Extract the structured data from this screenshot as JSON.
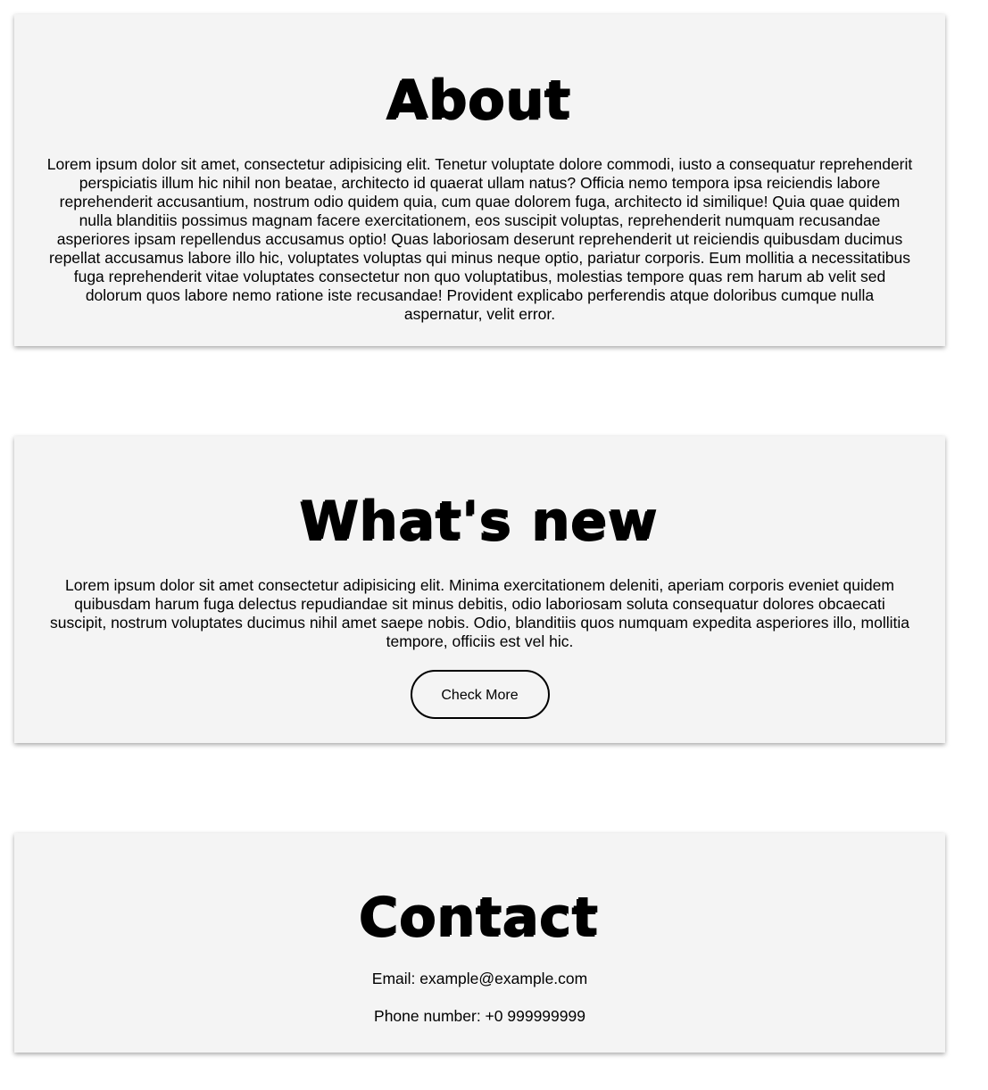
{
  "about": {
    "title": "About",
    "text": "Lorem ipsum dolor sit amet, consectetur adipisicing elit. Tenetur voluptate dolore commodi, iusto a consequatur reprehenderit perspiciatis illum hic nihil non beatae, architecto id quaerat ullam natus? Officia nemo tempora ipsa reiciendis labore reprehenderit accusantium, nostrum odio quidem quia, cum quae dolorem fuga, architecto id similique! Quia quae quidem nulla blanditiis possimus magnam facere exercitationem, eos suscipit voluptas, reprehenderit numquam recusandae asperiores ipsam repellendus accusamus optio! Quas laboriosam deserunt reprehenderit ut reiciendis quibusdam ducimus repellat accusamus labore illo hic, voluptates voluptas qui minus neque optio, pariatur corporis. Eum mollitia a necessitatibus fuga reprehenderit vitae voluptates consectetur non quo voluptatibus, molestias tempore quas rem harum ab velit sed dolorum quos labore nemo ratione iste recusandae! Provident explicabo perferendis atque doloribus cumque nulla aspernatur, velit error."
  },
  "whats_new": {
    "title": "What's new",
    "text": "Lorem ipsum dolor sit amet consectetur adipisicing elit. Minima exercitationem deleniti, aperiam corporis eveniet quidem quibusdam harum fuga delectus repudiandae sit minus debitis, odio laboriosam soluta consequatur dolores obcaecati suscipit, nostrum voluptates ducimus nihil amet saepe nobis. Odio, blanditiis quos numquam expedita asperiores illo, mollitia tempore, officiis est vel hic.",
    "button_label": "Check More"
  },
  "contact": {
    "title": "Contact",
    "email": "Email: example@example.com",
    "phone": "Phone number: +0 999999999"
  }
}
